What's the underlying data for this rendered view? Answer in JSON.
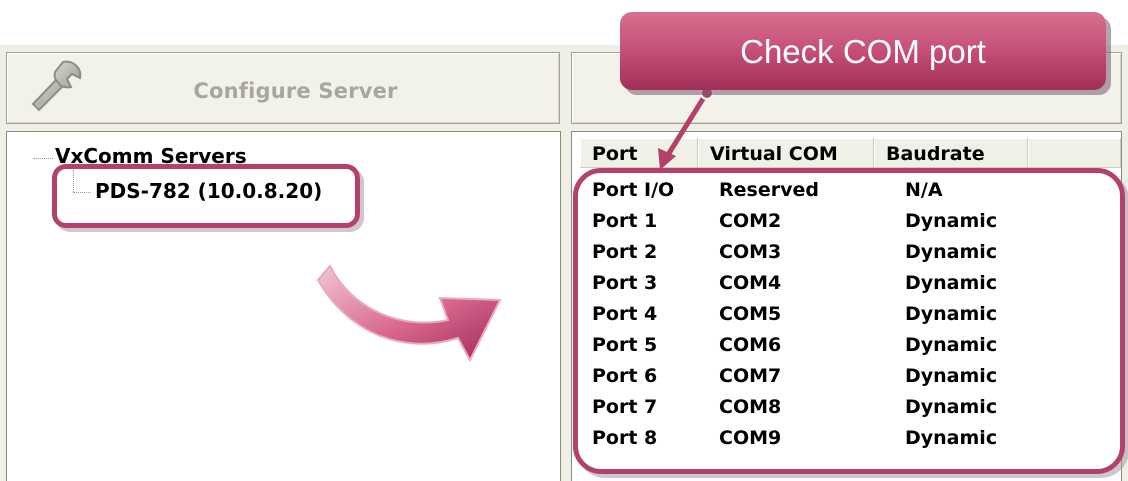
{
  "toolbar": {
    "configure_server_label": "Configure Server",
    "configure_port_label": ""
  },
  "tree": {
    "root_label": "VxComm Servers",
    "child_label": "PDS-782 (10.0.8.20)"
  },
  "port_list": {
    "columns": [
      "Port",
      "Virtual COM",
      "Baudrate"
    ],
    "rows": [
      {
        "port": "Port I/O",
        "virtual_com": "Reserved",
        "baudrate": "N/A"
      },
      {
        "port": "Port 1",
        "virtual_com": "COM2",
        "baudrate": "Dynamic"
      },
      {
        "port": "Port 2",
        "virtual_com": "COM3",
        "baudrate": "Dynamic"
      },
      {
        "port": "Port 3",
        "virtual_com": "COM4",
        "baudrate": "Dynamic"
      },
      {
        "port": "Port 4",
        "virtual_com": "COM5",
        "baudrate": "Dynamic"
      },
      {
        "port": "Port 5",
        "virtual_com": "COM6",
        "baudrate": "Dynamic"
      },
      {
        "port": "Port 6",
        "virtual_com": "COM7",
        "baudrate": "Dynamic"
      },
      {
        "port": "Port 7",
        "virtual_com": "COM8",
        "baudrate": "Dynamic"
      },
      {
        "port": "Port 8",
        "virtual_com": "COM9",
        "baudrate": "Dynamic"
      }
    ]
  },
  "annotation": {
    "callout_text": "Check COM port",
    "highlight_color": "#b2426a",
    "callout_color": "#c54f76"
  },
  "icons": {
    "configure_server": "wrench-icon",
    "flow_arrow": "curved-arrow-icon"
  }
}
